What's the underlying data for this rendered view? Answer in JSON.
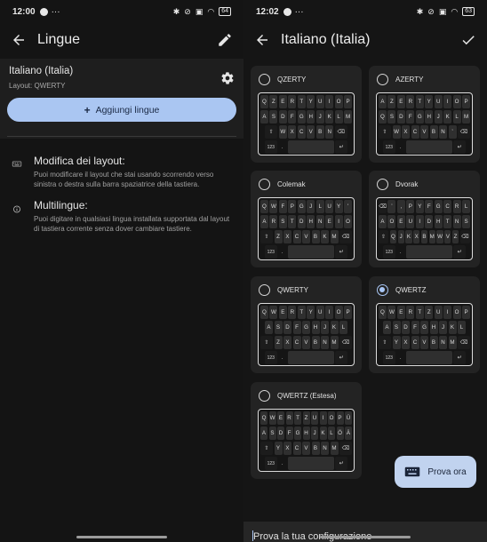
{
  "left": {
    "status": {
      "time": "12:00",
      "battery": "64"
    },
    "title": "Lingue",
    "language": {
      "name": "Italiano (Italia)",
      "layout": "Layout: QWERTY"
    },
    "add_button": "Aggiungi lingue",
    "info": [
      {
        "title": "Modifica dei layout:",
        "desc": "Puoi modificare il layout che stai usando scorrendo verso sinistra o destra sulla barra spaziatrice della tastiera."
      },
      {
        "title": "Multilingue:",
        "desc": "Puoi digitare in qualsiasi lingua installata supportata dal layout di tastiera corrente senza dover cambiare tastiere."
      }
    ]
  },
  "right": {
    "status": {
      "time": "12:02",
      "battery": "63"
    },
    "title": "Italiano (Italia)",
    "layouts": [
      {
        "name": "QZERTY",
        "selected": false,
        "rows": [
          [
            "Q",
            "Z",
            "E",
            "R",
            "T",
            "Y",
            "U",
            "I",
            "O",
            "P"
          ],
          [
            "A",
            "S",
            "D",
            "F",
            "G",
            "H",
            "J",
            "K",
            "L",
            "M"
          ],
          [
            "W",
            "X",
            "C",
            "V",
            "B",
            "N"
          ]
        ]
      },
      {
        "name": "AZERTY",
        "selected": false,
        "rows": [
          [
            "A",
            "Z",
            "E",
            "R",
            "T",
            "Y",
            "U",
            "I",
            "O",
            "P"
          ],
          [
            "Q",
            "S",
            "D",
            "F",
            "G",
            "H",
            "J",
            "K",
            "L",
            "M"
          ],
          [
            "W",
            "X",
            "C",
            "V",
            "B",
            "N",
            "’"
          ]
        ]
      },
      {
        "name": "Colemak",
        "selected": false,
        "rows": [
          [
            "Q",
            "W",
            "F",
            "P",
            "G",
            "J",
            "L",
            "U",
            "Y",
            "'"
          ],
          [
            "A",
            "R",
            "S",
            "T",
            "D",
            "H",
            "N",
            "E",
            "I",
            "O"
          ],
          [
            "Z",
            "X",
            "C",
            "V",
            "B",
            "K",
            "M"
          ]
        ]
      },
      {
        "name": "Dvorak",
        "selected": false,
        "rows": [
          [
            "’",
            ",",
            "P",
            "Y",
            "F",
            "G",
            "C",
            "R",
            "L"
          ],
          [
            "A",
            "O",
            "E",
            "U",
            "I",
            "D",
            "H",
            "T",
            "N",
            "S"
          ],
          [
            "Q",
            "J",
            "K",
            "X",
            "B",
            "M",
            "W",
            "V",
            "Z"
          ]
        ]
      },
      {
        "name": "QWERTY",
        "selected": false,
        "rows": [
          [
            "Q",
            "W",
            "E",
            "R",
            "T",
            "Y",
            "U",
            "I",
            "O",
            "P"
          ],
          [
            "A",
            "S",
            "D",
            "F",
            "G",
            "H",
            "J",
            "K",
            "L"
          ],
          [
            "Z",
            "X",
            "C",
            "V",
            "B",
            "N",
            "M"
          ]
        ]
      },
      {
        "name": "QWERTZ",
        "selected": true,
        "rows": [
          [
            "Q",
            "W",
            "E",
            "R",
            "T",
            "Z",
            "U",
            "I",
            "O",
            "P"
          ],
          [
            "A",
            "S",
            "D",
            "F",
            "G",
            "H",
            "J",
            "K",
            "L"
          ],
          [
            "Y",
            "X",
            "C",
            "V",
            "B",
            "N",
            "M"
          ]
        ]
      },
      {
        "name": "QWERTZ (Estesa)",
        "selected": false,
        "rows": [
          [
            "Q",
            "W",
            "E",
            "R",
            "T",
            "Z",
            "U",
            "I",
            "O",
            "P",
            "Ü"
          ],
          [
            "A",
            "S",
            "D",
            "F",
            "G",
            "H",
            "J",
            "K",
            "L",
            "Ö",
            "Ä"
          ],
          [
            "Y",
            "X",
            "C",
            "V",
            "B",
            "N",
            "M"
          ]
        ]
      }
    ],
    "num_key": "123",
    "period_key": ".",
    "try_button": "Prova ora",
    "try_input": "Prova la tua configurazione"
  }
}
